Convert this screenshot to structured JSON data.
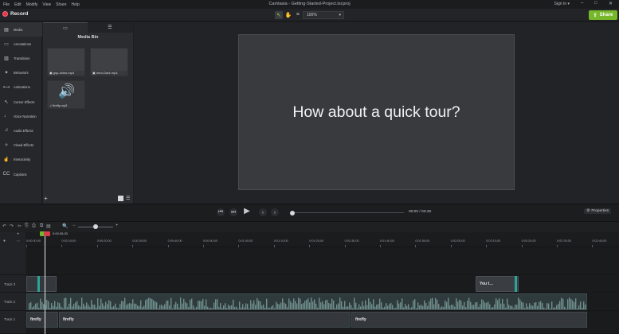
{
  "titlebar": {
    "menu": [
      "File",
      "Edit",
      "Modify",
      "View",
      "Share",
      "Help"
    ],
    "title": "Camtasia - Getting-Started-Project.tscproj",
    "signin": "Sign In ▾",
    "controls": [
      "–",
      "□",
      "✕"
    ]
  },
  "toolbar": {
    "record_label": "Record",
    "zoom_value": "100%",
    "share_label": "Share"
  },
  "sidebar": {
    "items": [
      {
        "label": "Media",
        "icon": "media-icon"
      },
      {
        "label": "Annotations",
        "icon": "annotations-icon"
      },
      {
        "label": "Transitions",
        "icon": "transitions-icon"
      },
      {
        "label": "Behaviors",
        "icon": "behaviors-icon"
      },
      {
        "label": "Animations",
        "icon": "animations-icon"
      },
      {
        "label": "Cursor Effects",
        "icon": "cursor-effects-icon"
      },
      {
        "label": "Voice Narration",
        "icon": "microphone-icon"
      },
      {
        "label": "Audio Effects",
        "icon": "audio-effects-icon"
      },
      {
        "label": "Visual Effects",
        "icon": "visual-effects-icon"
      },
      {
        "label": "Interactivity",
        "icon": "interactivity-icon"
      },
      {
        "label": "Captions",
        "icon": "captions-icon"
      }
    ]
  },
  "media_bin": {
    "title": "Media Bin",
    "items": [
      {
        "name": "gsp-video.mp4",
        "kind": "video"
      },
      {
        "name": "Intro-Dark.mp4",
        "kind": "video"
      },
      {
        "name": "firefly.mp3",
        "kind": "audio"
      }
    ]
  },
  "canvas": {
    "text": "How about a quick tour?"
  },
  "playback": {
    "time_readout": "00:00 / 03:48",
    "properties_label": "Properties"
  },
  "timeline": {
    "playhead_time": "0:00:05;20",
    "ticks": [
      "0:00:00;00",
      "0:00:10;00",
      "0:00:20;00",
      "0:00:30;00",
      "0:00:40;00",
      "0:00:50;00",
      "0:01:00;00",
      "0:01:10;00",
      "0:01:20;00",
      "0:01:30;00",
      "0:01:40;00",
      "0:01:50;00",
      "0:02:00;00",
      "0:02:10;00",
      "0:02:20;00",
      "0:02:30;00",
      "0:02:40;00"
    ],
    "tracks": [
      {
        "name": "Track 3"
      },
      {
        "name": "Track 2"
      },
      {
        "name": "Track 1"
      }
    ],
    "track3_clip_label": "You t…",
    "track1_clip_labels": [
      "firefly",
      "firefly",
      "firefly"
    ]
  },
  "colors": {
    "accent_green": "#77b82a",
    "record_red": "#e2374a",
    "marker_teal": "#2aa59a"
  }
}
